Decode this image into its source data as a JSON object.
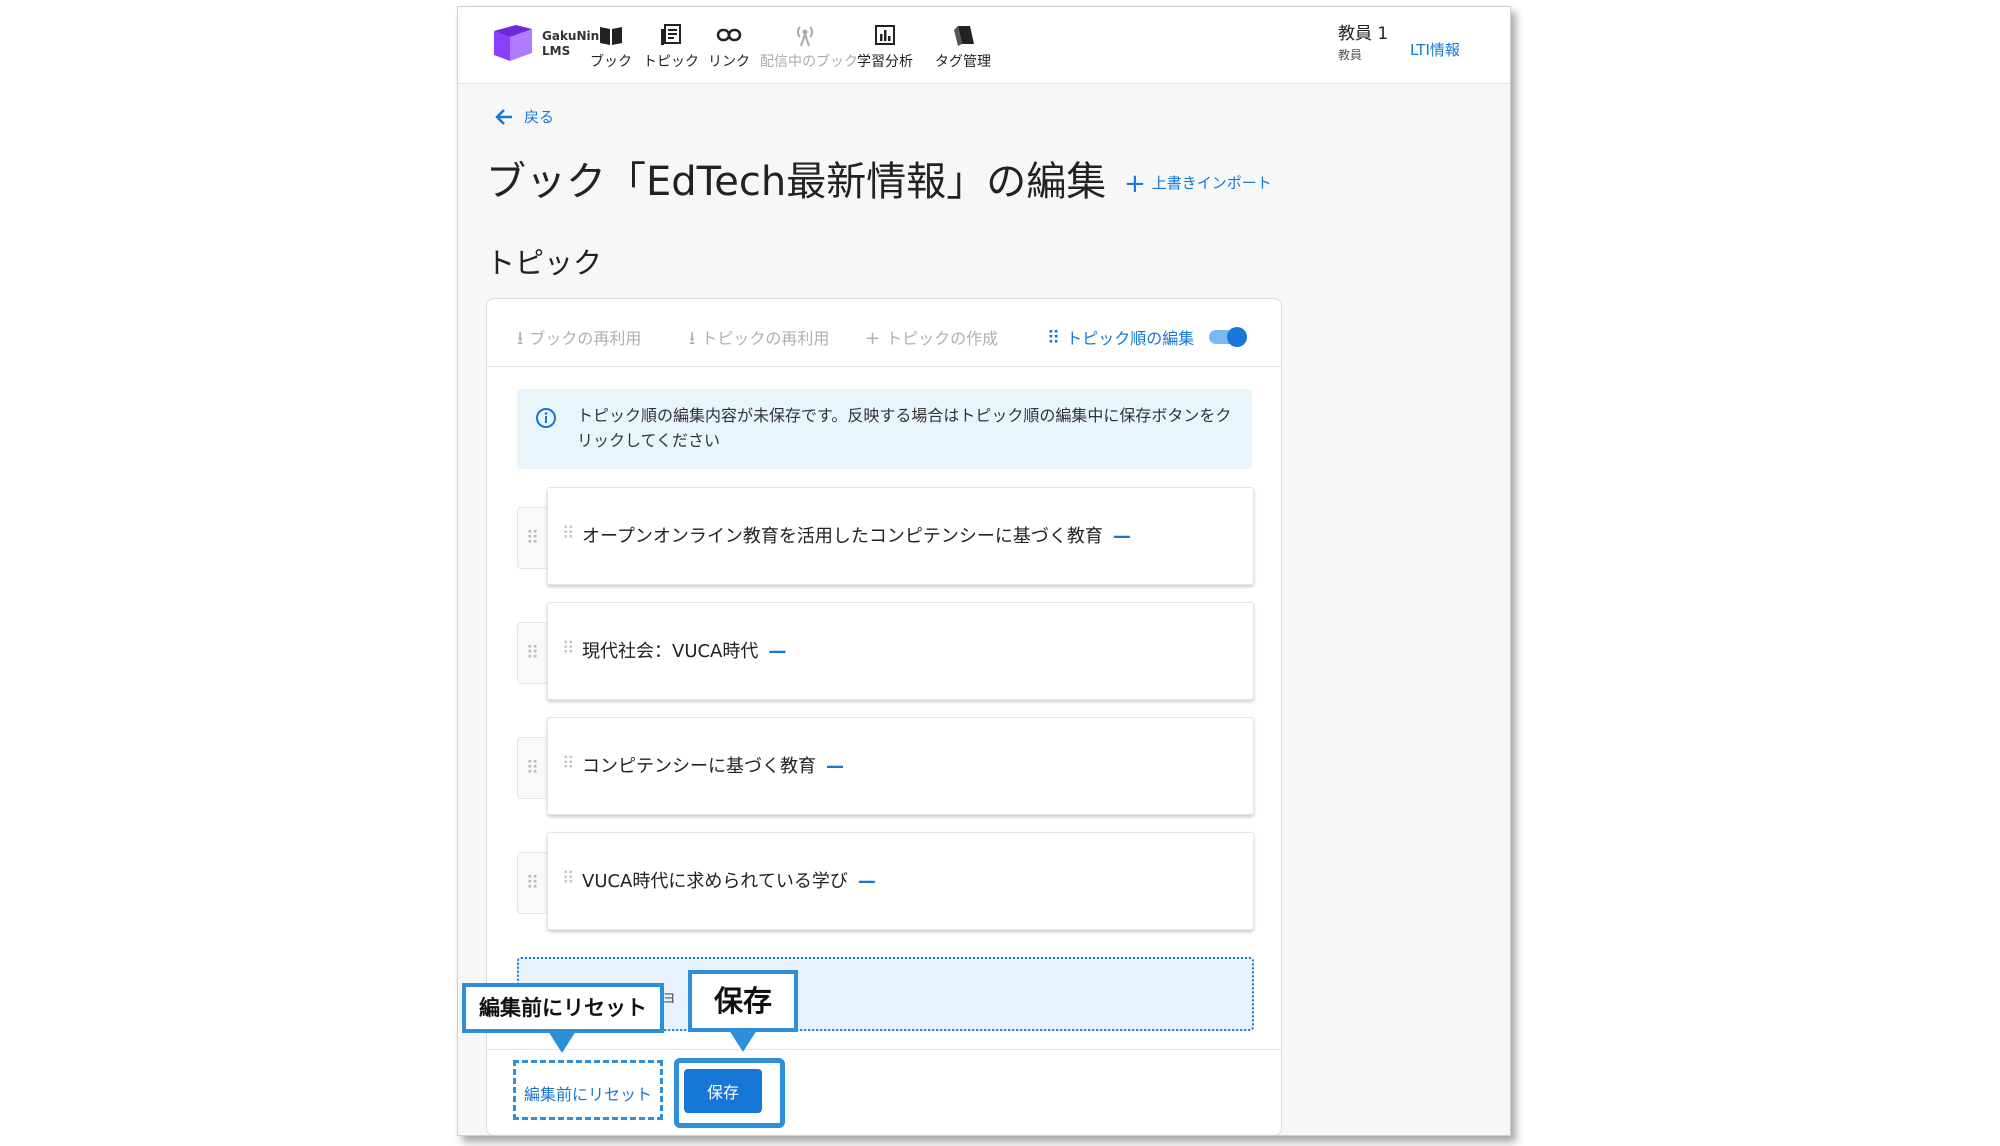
{
  "app": {
    "logo_line1": "GakuNin",
    "logo_line2": "LMS"
  },
  "nav": [
    {
      "label": "ブック",
      "icon": "book-icon",
      "disabled": false
    },
    {
      "label": "トピック",
      "icon": "topic-icon",
      "disabled": false
    },
    {
      "label": "リンク",
      "icon": "link-icon",
      "disabled": false
    },
    {
      "label": "配信中のブック",
      "icon": "broadcast-icon",
      "disabled": true
    },
    {
      "label": "学習分析",
      "icon": "chart-icon",
      "disabled": false
    },
    {
      "label": "タグ管理",
      "icon": "tag-icon",
      "disabled": false
    }
  ],
  "user": {
    "name": "教員 1",
    "role": "教員",
    "lti_link": "LTI情報"
  },
  "page": {
    "back_label": "戻る",
    "title": "ブック「EdTech最新情報」の編集",
    "import_label": "上書きインポート",
    "section_title": "トピック"
  },
  "toolbar": {
    "reuse_book": "ブックの再利用",
    "reuse_topic": "トピックの再利用",
    "create_topic": "トピックの作成",
    "edit_order": "トピック順の編集",
    "edit_order_toggle_on": true
  },
  "info_message": "トピック順の編集内容が未保存です。反映する場合はトピック順の編集中に保存ボタンをクリックしてください",
  "topics": [
    "オープンオンライン教育を活用したコンピテンシーに基づく教育",
    "現代社会：VUCA時代",
    "コンピテンシーに基づく教育",
    "VUCA時代に求められている学び"
  ],
  "dropzone_partial_text": "ョ",
  "footer": {
    "reset_label": "編集前にリセット",
    "save_label": "保存"
  },
  "callouts": {
    "reset": "編集前にリセット",
    "save": "保存"
  },
  "colors": {
    "accent": "#1677d6",
    "callout_border": "#2e8fd8",
    "info_bg": "#e8f5fb",
    "logo": "#8a3ffc"
  }
}
